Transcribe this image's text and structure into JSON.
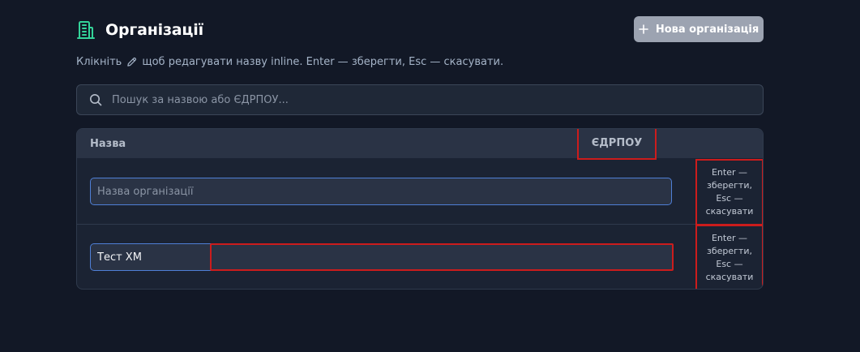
{
  "header": {
    "title": "Організації",
    "new_button_label": "Нова організація"
  },
  "hint": {
    "before": "Клікніть",
    "after": "щоб редагувати назву inline. Enter — зберегти, Esc — скасувати."
  },
  "search": {
    "placeholder": "Пошук за назвою або ЄДРПОУ..."
  },
  "table": {
    "columns": [
      "Назва",
      "ЄДРПОУ"
    ],
    "rows": [
      {
        "name_value": "",
        "name_placeholder": "Назва організації",
        "edrpou_value": "",
        "action_hint": "Enter — зберегти, Esc — скасувати"
      },
      {
        "name_value": "Тест ХМ",
        "name_placeholder": "",
        "edrpou_value": "",
        "action_hint": "Enter — зберегти, Esc — скасувати"
      }
    ]
  },
  "icons": {
    "title": "building-icon",
    "button": "plus-icon",
    "hint": "pencil-icon",
    "search": "search-icon"
  },
  "colors": {
    "background": "#121826",
    "accent": "#34d399",
    "button_bg": "#9ca3b1",
    "highlight": "#cc1c1c",
    "input_focus": "#4f7fd6"
  }
}
